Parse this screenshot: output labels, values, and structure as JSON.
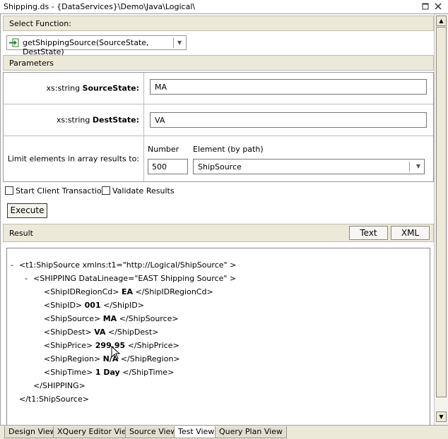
{
  "window": {
    "title": "Shipping.ds - {DataServices}\\Demo\\Java\\Logical\\"
  },
  "select_function": {
    "header": "Select Function:",
    "value": "getShippingSource(SourceState, DestState)"
  },
  "parameters": {
    "header": "Parameters",
    "source_state": {
      "type": "xs:string ",
      "name": "SourceState:",
      "value": "MA"
    },
    "dest_state": {
      "type": "xs:string ",
      "name": "DestState:",
      "value": "VA"
    },
    "limit": {
      "label": "Limit elements in array results to:",
      "number_label": "Number",
      "element_label": "Element (by path)",
      "number_value": "500",
      "element_value": "ShipSource"
    }
  },
  "options": {
    "start_client_transaction": "Start Client Transaction",
    "validate_results": "Validate Results"
  },
  "execute_label": "Execute",
  "result": {
    "header": "Result",
    "text_button": "Text",
    "xml_button": "XML",
    "lines": [
      {
        "toggle": "-",
        "open": "<t1:ShipSource xmlns:t1=\"http://Logical/ShipSource\" >"
      },
      {
        "toggle": "-",
        "open": "<SHIPPING DataLineage=\"EAST Shipping Source\" >"
      },
      {
        "open": "<ShipIDRegionCd>",
        "value": "EA",
        "close": "</ShipIDRegionCd>"
      },
      {
        "open": "<ShipID>",
        "value": "001",
        "close": "</ShipID>"
      },
      {
        "open": "<ShipSource>",
        "value": "MA",
        "close": "</ShipSource>"
      },
      {
        "open": "<ShipDest>",
        "value": "VA",
        "close": "</ShipDest>"
      },
      {
        "open": "<ShipPrice>",
        "value": "299.95",
        "close": "</ShipPrice>"
      },
      {
        "open": "<ShipRegion>",
        "value": "N/A",
        "close": "</ShipRegion>"
      },
      {
        "open": "<ShipTime>",
        "value": "1 Day",
        "close": "</ShipTime>"
      },
      {
        "open": "</SHIPPING>"
      },
      {
        "open": "</t1:ShipSource>"
      }
    ]
  },
  "tabs": [
    "Design View",
    "XQuery Editor View",
    "Source View",
    "Test View",
    "Query Plan View"
  ],
  "active_tab": "Test View"
}
